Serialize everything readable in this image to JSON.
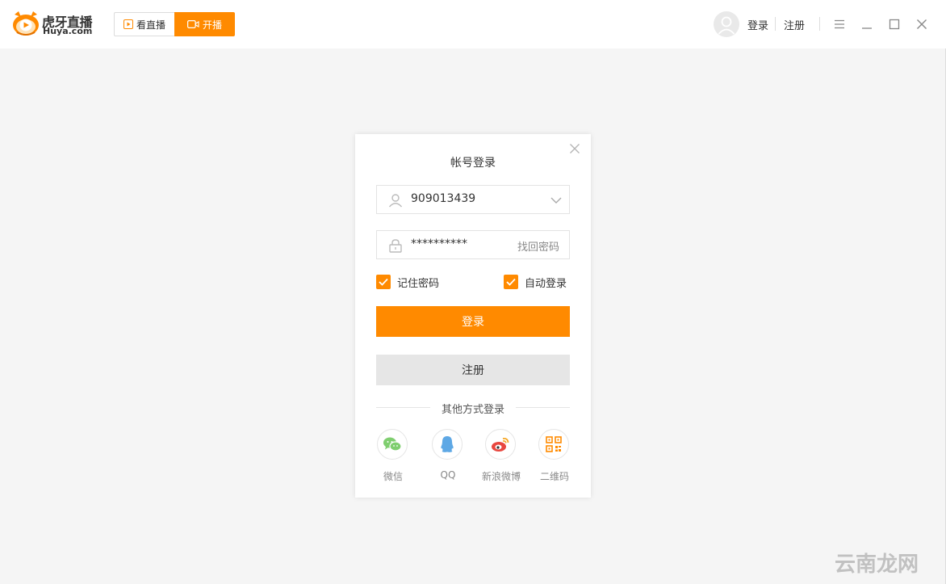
{
  "app": {
    "logo_text": "虎牙直播",
    "logo_subtext": "Huya.com"
  },
  "mode_tabs": {
    "watch_label": "看直播",
    "stream_label": "开播"
  },
  "header": {
    "login_label": "登录",
    "register_label": "注册"
  },
  "dialog": {
    "title": "帐号登录",
    "account_value": "909013439",
    "password_value": "**********",
    "forgot_password_label": "找回密码",
    "remember_password_label": "记住密码",
    "remember_password_checked": true,
    "auto_login_label": "自动登录",
    "auto_login_checked": true,
    "login_button_label": "登录",
    "register_button_label": "注册",
    "other_methods_label": "其他方式登录",
    "social": [
      {
        "label": "微信",
        "icon": "wechat-icon"
      },
      {
        "label": "QQ",
        "icon": "qq-icon"
      },
      {
        "label": "新浪微博",
        "icon": "weibo-icon"
      },
      {
        "label": "二维码",
        "icon": "qrcode-icon"
      }
    ]
  },
  "colors": {
    "accent": "#ff8a00",
    "background": "#f5f5f5",
    "register_button": "#e6e6e6"
  },
  "watermark": {
    "text": "云南龙网"
  }
}
